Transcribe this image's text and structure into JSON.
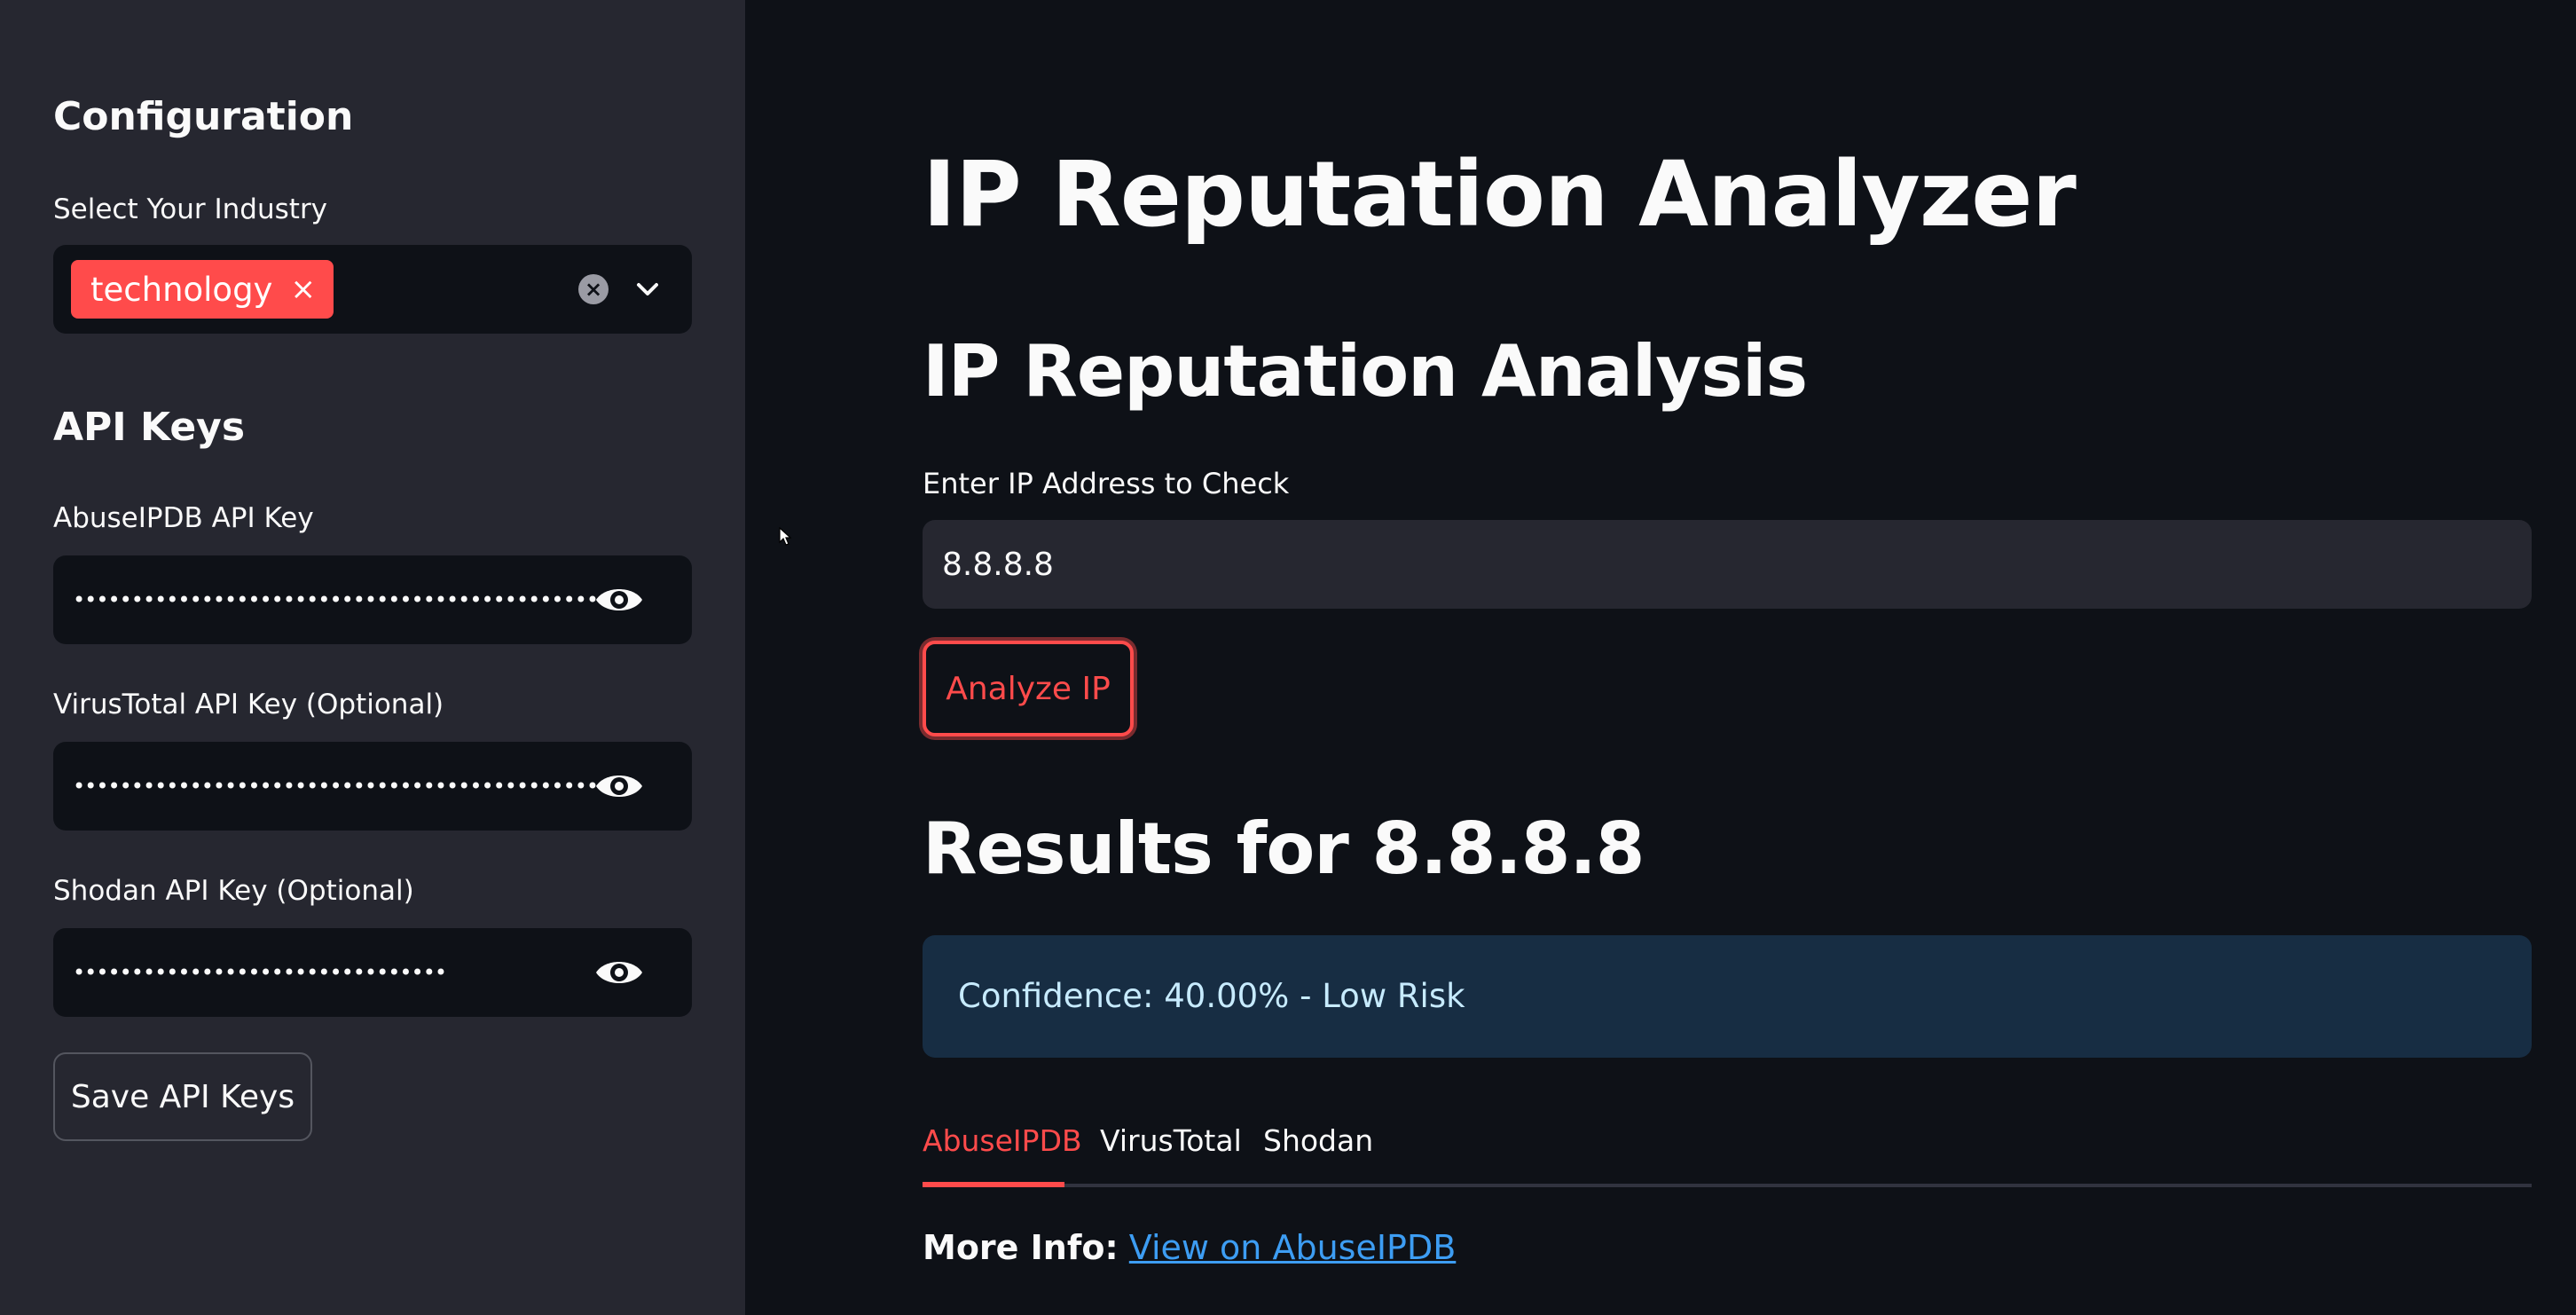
{
  "sidebar": {
    "config_heading": "Configuration",
    "industry_label": "Select Your Industry",
    "industry_selected": "technology",
    "api_keys_heading": "API Keys",
    "abuseipdb_label": "AbuseIPDB API Key",
    "abuseipdb_mask": "••••••••••••••••••••••••••••••••••••••••••••••••••••••••••••••••••••",
    "virustotal_label": "VirusTotal API Key (Optional)",
    "virustotal_mask": "••••••••••••••••••••••••••••••••••••••••••••••••••••••••••••••••••••",
    "shodan_label": "Shodan API Key (Optional)",
    "shodan_mask": "••••••••••••••••••••••••••••••••",
    "save_label": "Save API Keys",
    "icons": {
      "clear": "clear-icon",
      "chevron": "chevron-down-icon",
      "eye": "eye-icon",
      "tag_remove": "close-icon"
    }
  },
  "main": {
    "title": "IP Reputation Analyzer",
    "section_heading": "IP Reputation Analysis",
    "input_label": "Enter IP Address to Check",
    "ip_value": "8.8.8.8",
    "analyze_label": "Analyze IP",
    "results_heading": "Results for 8.8.8.8",
    "confidence_text": "Confidence: 40.00% - Low Risk",
    "tabs": [
      {
        "label": "AbuseIPDB",
        "active": true
      },
      {
        "label": "VirusTotal",
        "active": false
      },
      {
        "label": "Shodan",
        "active": false
      }
    ],
    "more_info_label": "More Info:",
    "more_info_link": "View on AbuseIPDB"
  },
  "colors": {
    "accent": "#ff4b4b",
    "sidebar_bg": "#262730",
    "main_bg": "#0e1117",
    "info_bg": "#172d43",
    "link": "#3d9df3"
  }
}
